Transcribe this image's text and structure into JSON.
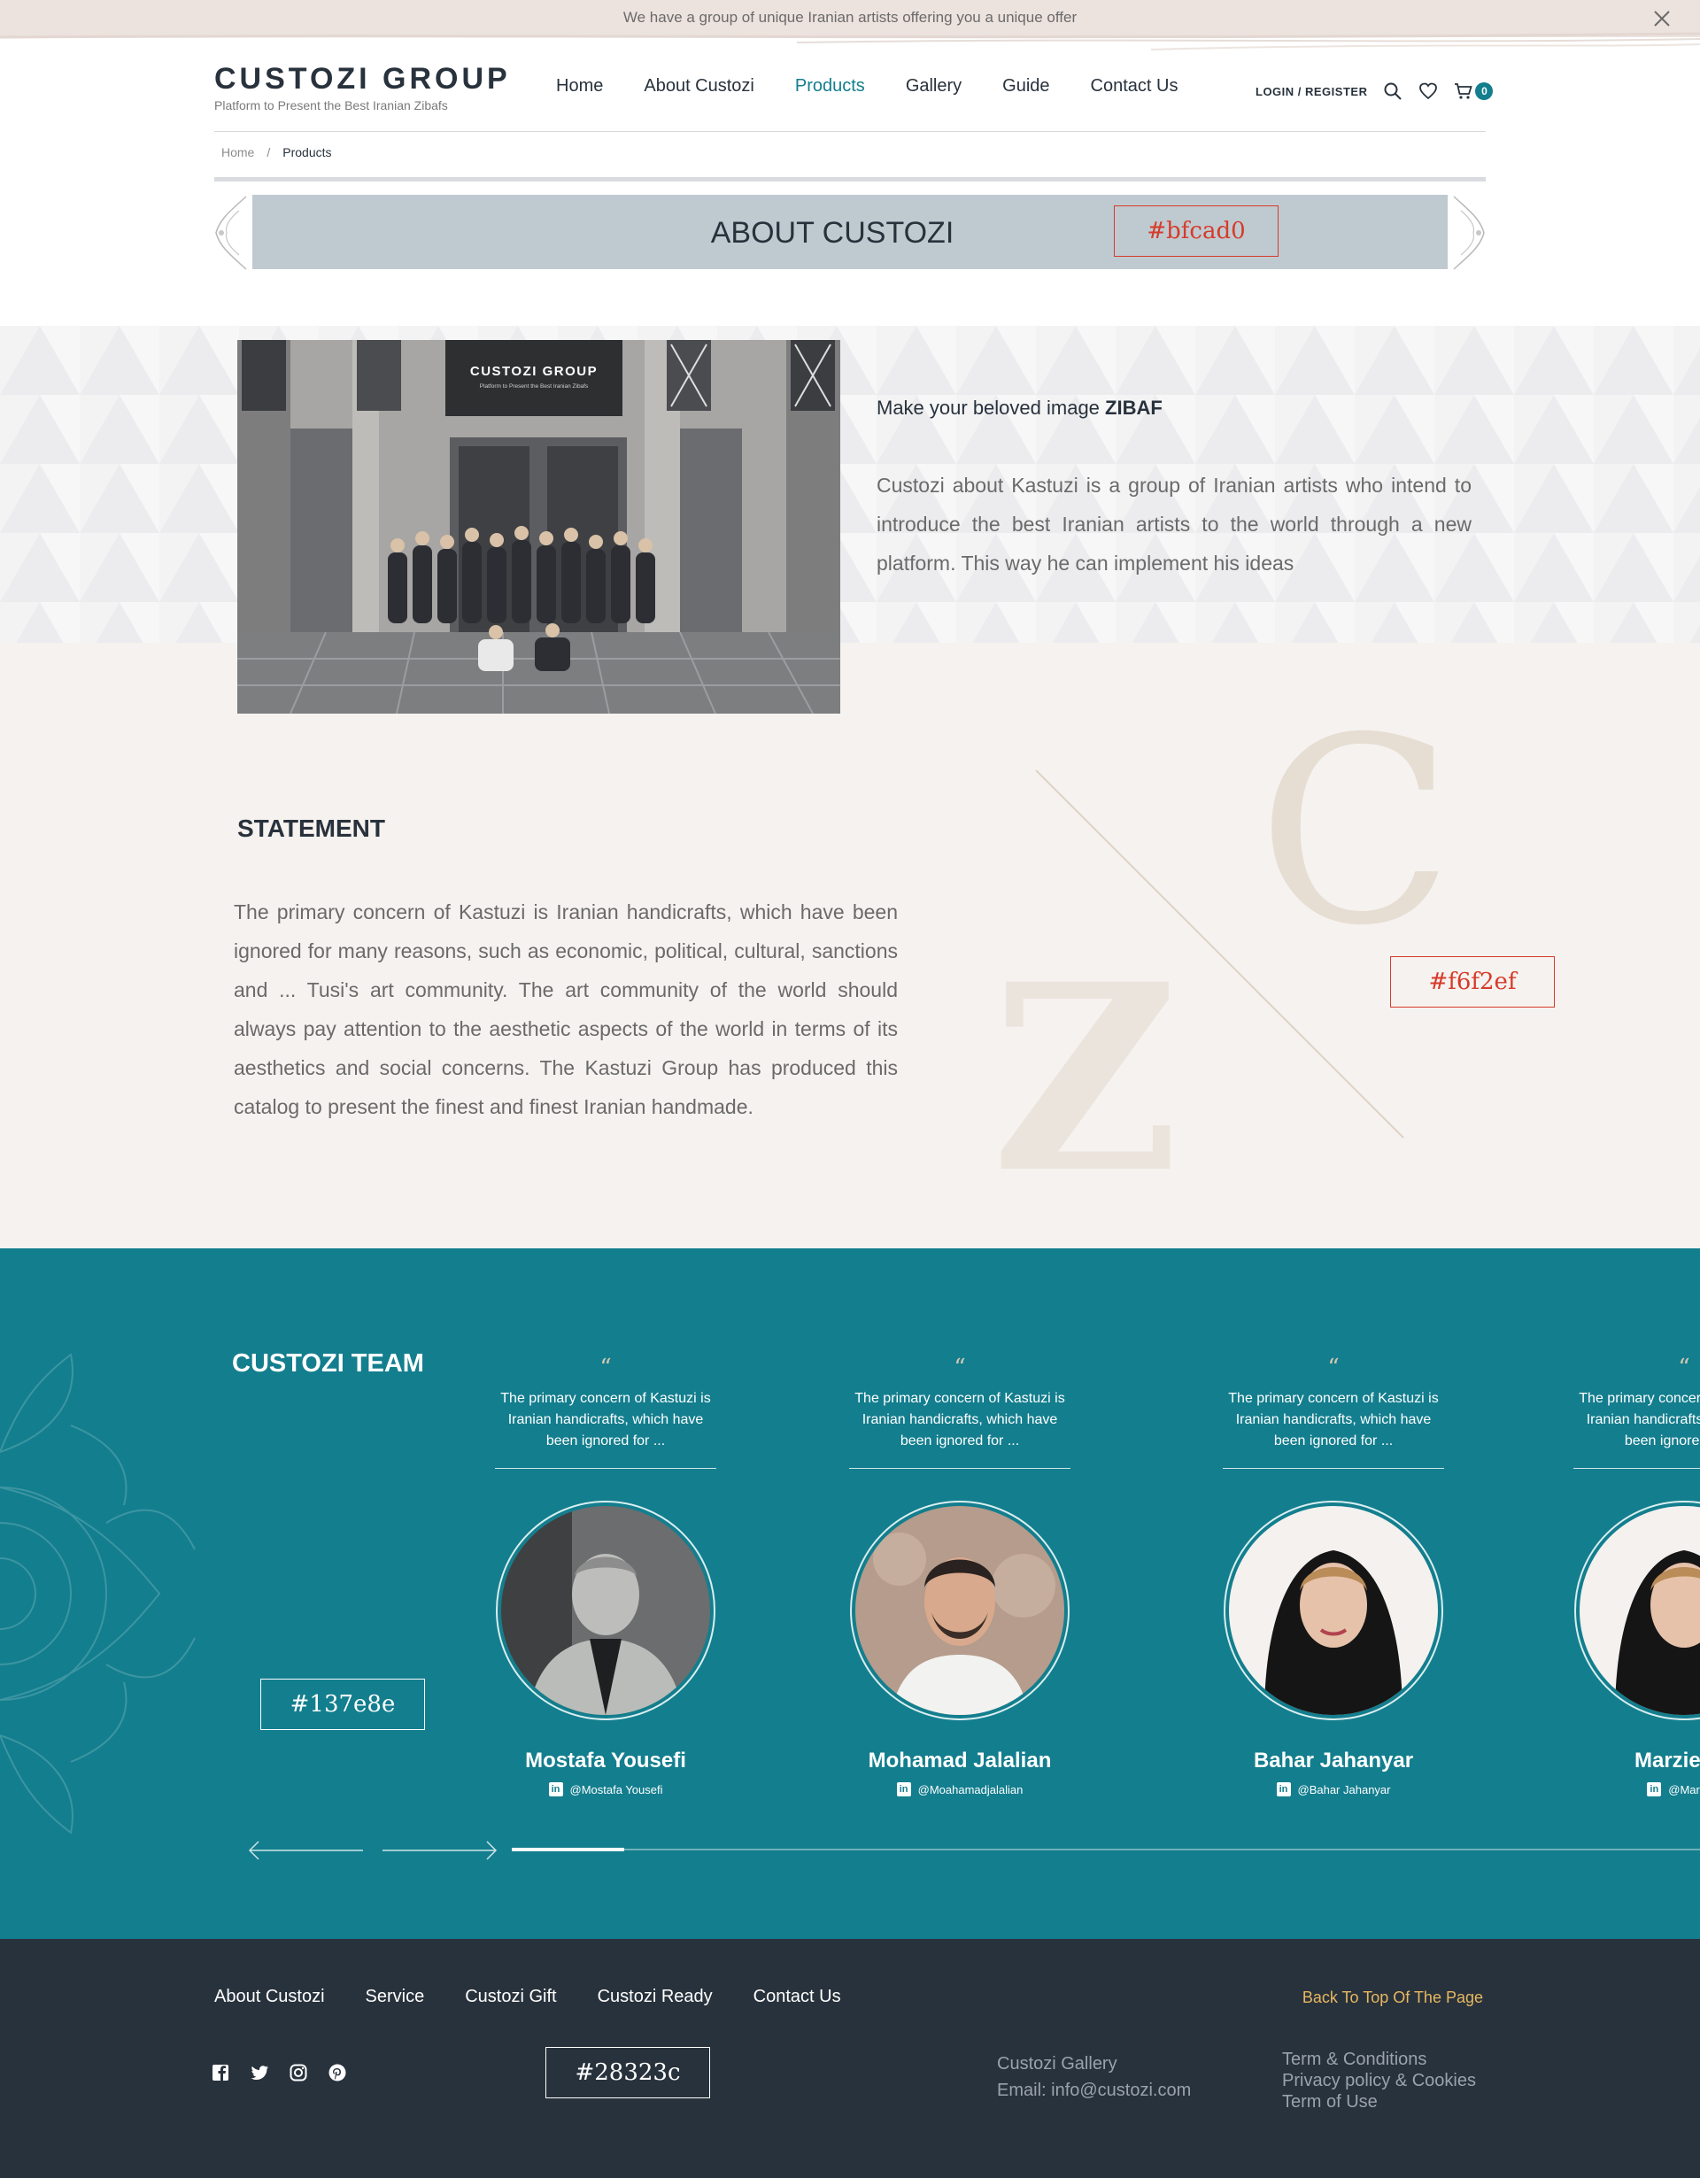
{
  "announcement": {
    "text": "We have a group of unique Iranian artists offering you a unique offer"
  },
  "brand": {
    "title": "CUSTOZI GROUP",
    "subtitle": "Platform to Present the Best Iranian Zibafs"
  },
  "nav": {
    "items": [
      {
        "label": "Home"
      },
      {
        "label": "About Custozi"
      },
      {
        "label": "Products"
      },
      {
        "label": "Gallery"
      },
      {
        "label": "Guide"
      },
      {
        "label": "Contact Us"
      }
    ],
    "active": "Products",
    "login_label": "LOGIN / REGISTER",
    "cart_count": "0"
  },
  "breadcrumb": {
    "home": "Home",
    "separator": "/",
    "current": "Products"
  },
  "banner": {
    "title": "ABOUT CUSTOZI",
    "swatch": "#bfcad0"
  },
  "intro": {
    "photo_sign_title": "CUSTOZI GROUP",
    "photo_sign_sub": "Platform to Present the Best Iranian Zibafs",
    "heading_prefix": "Make your beloved image",
    "heading_strong": "ZIBAF",
    "text": "Custozi about Kastuzi is a group of Iranian artists who intend to introduce the best Iranian artists to the world through a new platform. This way he can implement his ideas"
  },
  "statement": {
    "title": "STATEMENT",
    "text": "The primary concern of Kastuzi is Iranian handicrafts, which have been ignored for many reasons, such as economic, political, cultural, sanctions and ... Tusi's art community. The art community of the world should always pay attention to the aesthetic aspects of the world in terms of its aesthetics and social concerns. The Kastuzi Group has produced this catalog to present the finest and finest Iranian handmade.",
    "art_letters": {
      "top": "C",
      "bottom": "Z"
    },
    "swatch": "#f6f2ef"
  },
  "team": {
    "title": "CUSTOZI TEAM",
    "swatch": "#137e8e",
    "quote_mark": "“",
    "slider_progress": 0.095,
    "members": [
      {
        "quote": "The primary concern of Kastuzi is Iranian handicrafts, which have been ignored for ...",
        "name": "Mostafa Yousefi",
        "handle": "@Mostafa Yousefi"
      },
      {
        "quote": "The primary concern of Kastuzi is Iranian handicrafts, which have been ignored for ...",
        "name": "Mohamad Jalalian",
        "handle": "@Moahamadjalalian"
      },
      {
        "quote": "The primary concern of Kastuzi is Iranian handicrafts, which have been ignored for ...",
        "name": "Bahar Jahanyar",
        "handle": "@Bahar Jahanyar"
      },
      {
        "quote": "The primary concern of Kastuzi is Iranian handicrafts, which have been ignored for ...",
        "name": "Marzieh S",
        "handle": "@Marzieh"
      }
    ]
  },
  "footer": {
    "links": [
      {
        "label": "About Custozi"
      },
      {
        "label": "Service"
      },
      {
        "label": "Custozi Gift"
      },
      {
        "label": "Custozi Ready"
      },
      {
        "label": "Contact Us"
      }
    ],
    "back_to_top": "Back To Top Of The Page",
    "swatch": "#28323c",
    "contact": {
      "name": "Custozi Gallery",
      "email": "Email: info@custozi.com"
    },
    "legal": [
      {
        "label": "Term & Conditions"
      },
      {
        "label": "Privacy policy & Cookies"
      },
      {
        "label": "Term of Use"
      }
    ],
    "socials": [
      "facebook-icon",
      "twitter-icon",
      "instagram-icon",
      "pinterest-icon"
    ]
  },
  "colors": {
    "accent": "#137e8e",
    "dark": "#28323c",
    "banner": "#bfcad0",
    "cream": "#f6f2ef",
    "gold": "#e8b760",
    "swatch_border": "#d63b2a"
  }
}
